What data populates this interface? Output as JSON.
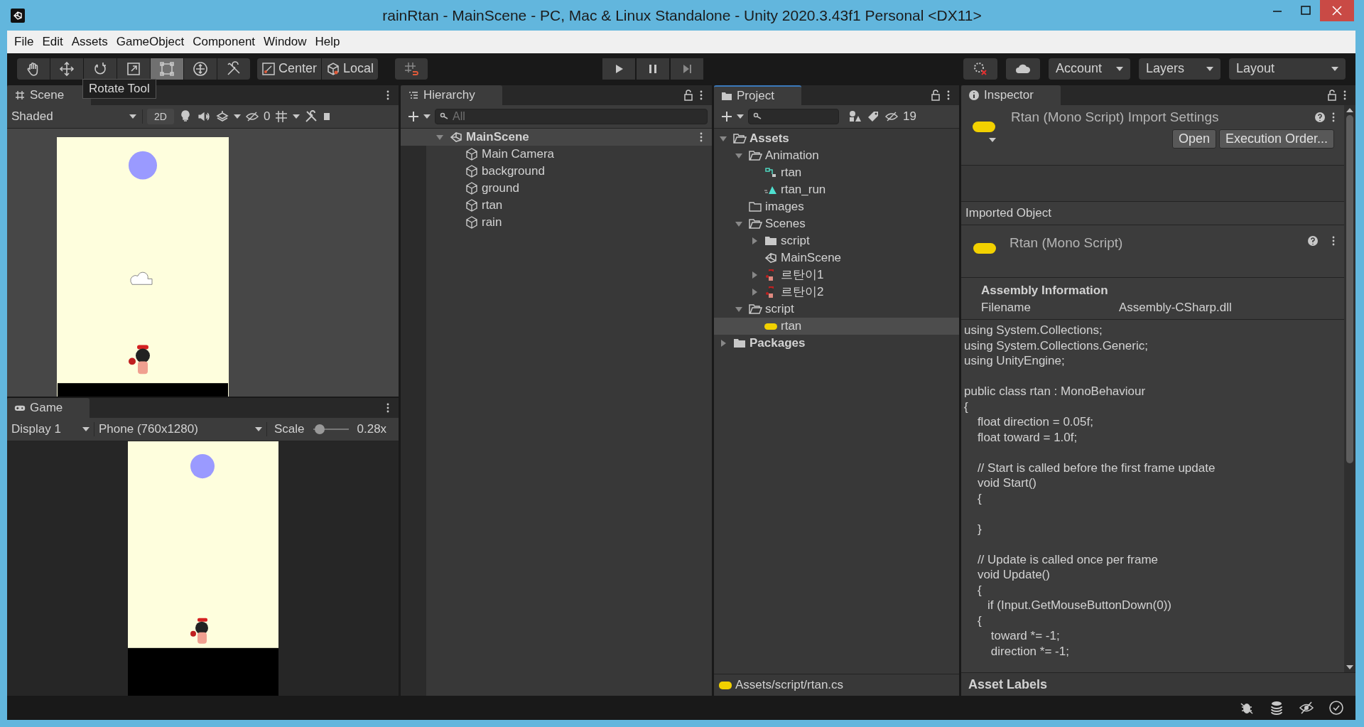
{
  "window": {
    "title": "rainRtan - MainScene - PC, Mac & Linux Standalone - Unity 2020.3.43f1 Personal <DX11>"
  },
  "menu": [
    "File",
    "Edit",
    "Assets",
    "GameObject",
    "Component",
    "Window",
    "Help"
  ],
  "toolbar": {
    "tools": [
      {
        "kind": "hand",
        "selected": false
      },
      {
        "kind": "move",
        "selected": false
      },
      {
        "kind": "rotate",
        "selected": false
      },
      {
        "kind": "scale",
        "selected": false
      },
      {
        "kind": "rect",
        "selected": true
      },
      {
        "kind": "transform",
        "selected": false
      },
      {
        "kind": "custom",
        "selected": false
      }
    ],
    "pivot": [
      {
        "kind": "center",
        "label": "Center"
      },
      {
        "kind": "local",
        "label": "Local"
      }
    ],
    "dropdowns": [
      "Account",
      "Layers",
      "Layout"
    ]
  },
  "tooltip": "Rotate Tool",
  "scene": {
    "tab": "Scene",
    "shading": "Shaded",
    "mode_button": "2D",
    "hidden_count": "0"
  },
  "game": {
    "tab": "Game",
    "display": "Display 1",
    "resolution": "Phone (760x1280)",
    "scale_label": "Scale",
    "scale": {
      "level": 0.05
    },
    "scale_reading": "0.28x"
  },
  "hierarchy": {
    "tab": "Hierarchy",
    "search": {
      "placeholder": "All"
    },
    "scene": {
      "name": "MainScene",
      "expanded": true,
      "children": [
        "Main Camera",
        "background",
        "ground",
        "rtan",
        "rain"
      ]
    }
  },
  "project": {
    "tab": "Project",
    "hidden_count": "19",
    "tree": [
      {
        "label": "Assets",
        "kind": "folder-open",
        "expanded": true,
        "selected": false,
        "children": [
          {
            "label": "Animation",
            "kind": "folder-open",
            "expanded": true,
            "selected": false,
            "children": [
              {
                "label": "rtan",
                "kind": "animator",
                "selected": false
              },
              {
                "label": "rtan_run",
                "kind": "clip",
                "selected": false
              }
            ]
          },
          {
            "label": "images",
            "kind": "folder-empty",
            "selected": false
          },
          {
            "label": "Scenes",
            "kind": "folder-open",
            "expanded": true,
            "selected": false,
            "children": [
              {
                "label": "script",
                "kind": "folder",
                "expanded": false,
                "selected": false
              },
              {
                "label": "MainScene",
                "kind": "scene",
                "selected": false
              },
              {
                "label": "르탄이1",
                "kind": "prefab",
                "expanded": false,
                "selected": false
              },
              {
                "label": "르탄이2",
                "kind": "prefab",
                "expanded": false,
                "selected": false
              }
            ]
          },
          {
            "label": "script",
            "kind": "folder-open",
            "expanded": true,
            "selected": false,
            "children": [
              {
                "label": "rtan",
                "kind": "script",
                "selected": true
              }
            ]
          }
        ]
      },
      {
        "label": "Packages",
        "kind": "folder",
        "expanded": false,
        "selected": false
      }
    ],
    "path": "Assets/script/rtan.cs"
  },
  "inspector": {
    "tab": "Inspector",
    "header_title": "Rtan (Mono Script) Import Settings",
    "buttons": [
      "Open",
      "Execution Order..."
    ],
    "section": "Imported Object",
    "object_title": "Rtan (Mono Script)",
    "assembly_heading": "Assembly Information",
    "fields": [
      {
        "label": "Filename",
        "value": "Assembly-CSharp.dll"
      }
    ],
    "code": "using System.Collections;\nusing System.Collections.Generic;\nusing UnityEngine;\n\npublic class rtan : MonoBehaviour\n{\n    float direction = 0.05f;\n    float toward = 1.0f;\n\n    // Start is called before the first frame update\n    void Start()\n    {\n\n    }\n\n    // Update is called once per frame\n    void Update()\n    {\n       if (Input.GetMouseButtonDown(0))\n    {\n        toward *= -1;\n        direction *= -1;",
    "labels_heading": "Asset Labels"
  }
}
